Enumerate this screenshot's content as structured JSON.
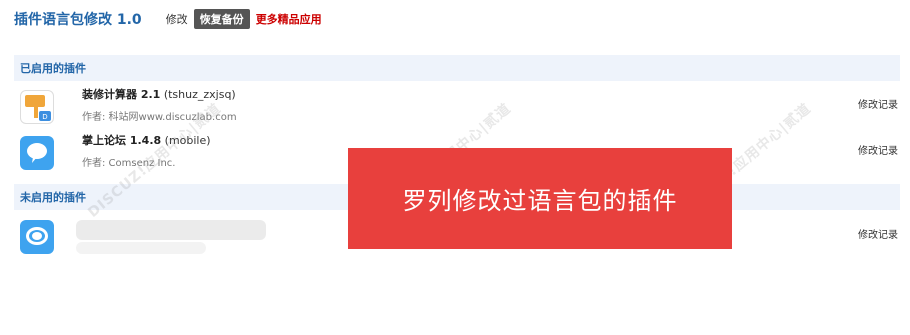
{
  "header": {
    "title": "插件语言包修改 1.0",
    "edit_link": "修改",
    "restore_button": "恢复备份",
    "more_apps_link": "更多精品应用"
  },
  "sections": {
    "enabled_title": "已启用的插件",
    "disabled_title": "未启用的插件"
  },
  "plugins": [
    {
      "name": "装修计算器 2.1",
      "id": "(tshuz_zxjsq)",
      "author": "作者: 科站网www.discuzlab.com",
      "log_label": "修改记录"
    },
    {
      "name": "掌上论坛 1.4.8",
      "id": "(mobile)",
      "author": "作者: Comsenz Inc.",
      "log_label": "修改记录"
    },
    {
      "log_label": "修改记录"
    }
  ],
  "banner": {
    "text": "罗列修改过语言包的插件"
  },
  "watermark": {
    "text": "DISCUZ!应用中心|贰道"
  },
  "colors": {
    "accent": "#2366a8",
    "section_bg": "#eef3fb",
    "banner_bg": "#e8403d",
    "more_link": "#cc0000"
  }
}
